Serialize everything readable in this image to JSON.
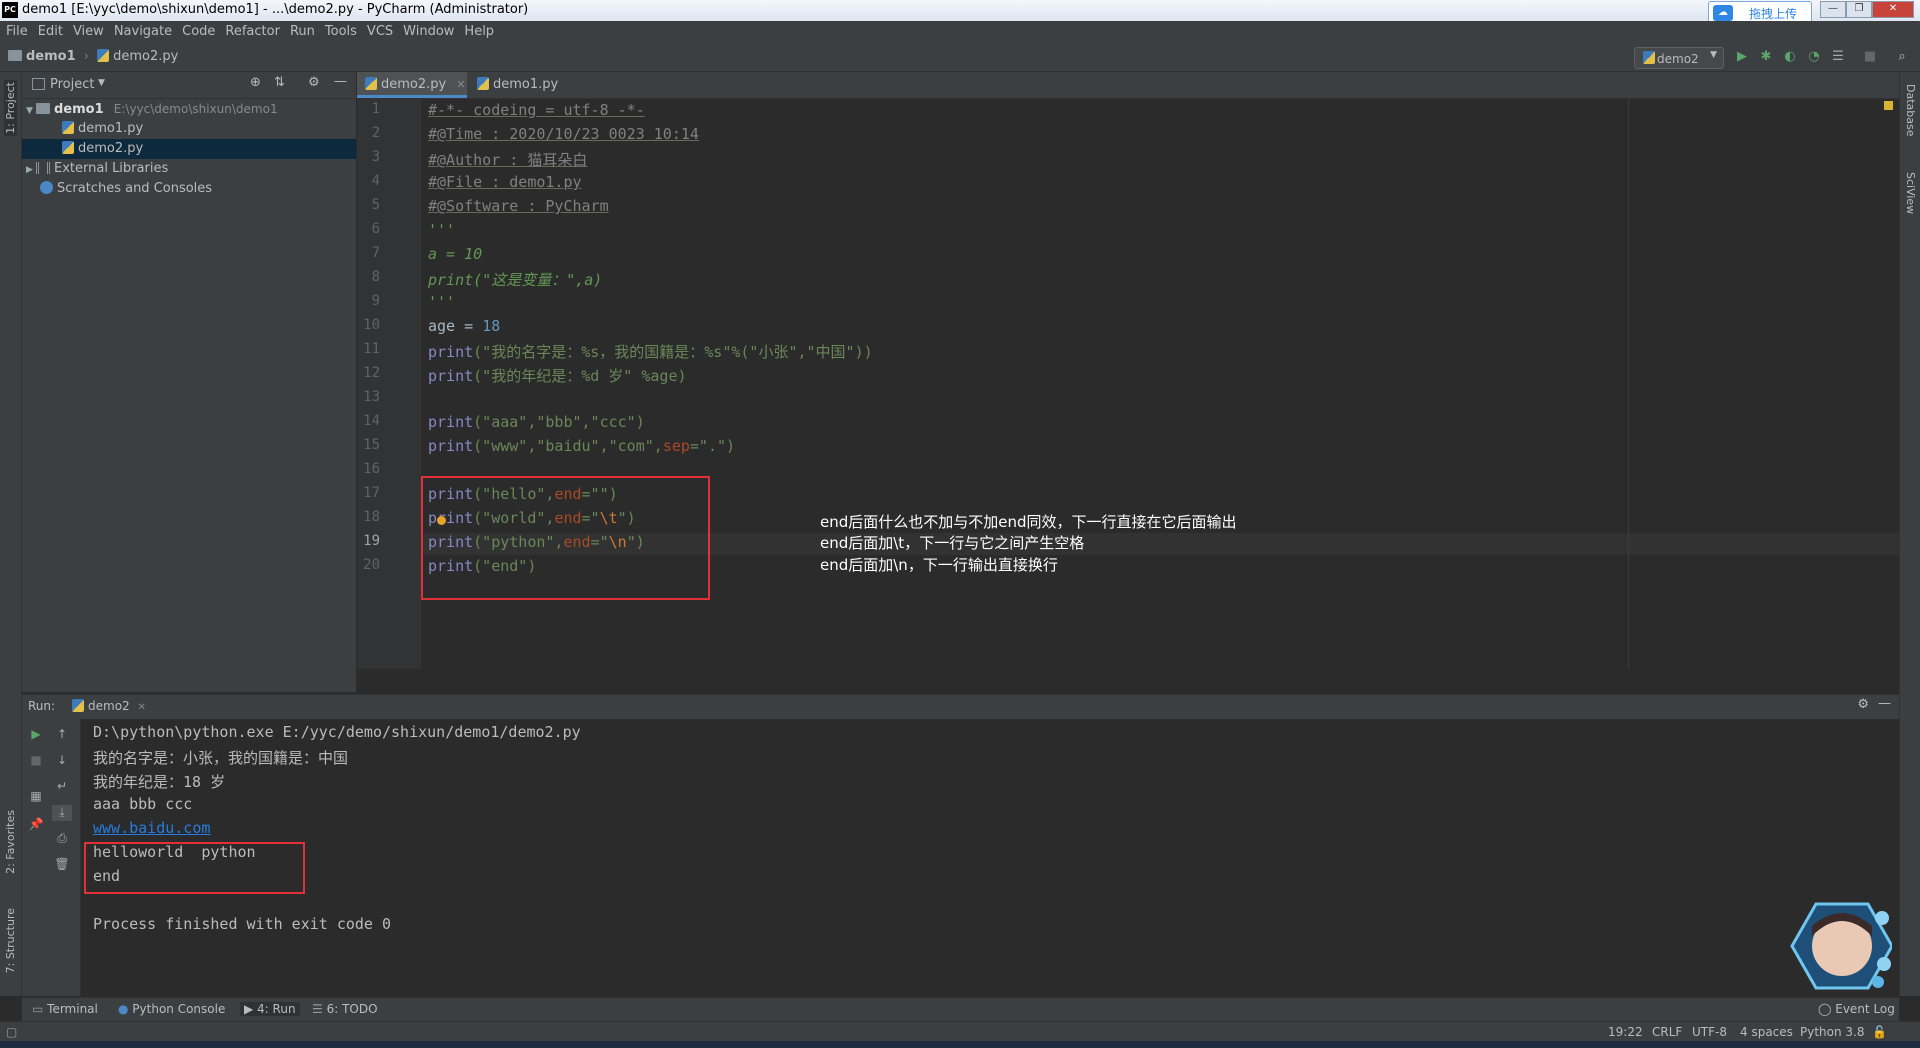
{
  "window": {
    "title": "demo1 [E:\\yyc\\demo\\shixun\\demo1] - ...\\demo2.py - PyCharm (Administrator)",
    "upload_label": "拖拽上传"
  },
  "menu": [
    "File",
    "Edit",
    "View",
    "Navigate",
    "Code",
    "Refactor",
    "Run",
    "Tools",
    "VCS",
    "Window",
    "Help"
  ],
  "breadcrumb": {
    "project": "demo1",
    "file": "demo2.py"
  },
  "run_config": "demo2",
  "left_strip": {
    "project_tab": "1: Project",
    "favorites_tab": "2: Favorites",
    "structure_tab": "7: Structure"
  },
  "right_strip": {
    "database_tab": "Database",
    "sciview_tab": "SciView"
  },
  "project_panel": {
    "title": "Project",
    "root": {
      "name": "demo1",
      "path": "E:\\yyc\\demo\\shixun\\demo1"
    },
    "files": [
      "demo1.py",
      "demo2.py"
    ],
    "selected": "demo2.py",
    "external": "External Libraries",
    "scratches": "Scratches and Consoles"
  },
  "tabs": [
    {
      "label": "demo2.py",
      "active": true
    },
    {
      "label": "demo1.py",
      "active": false
    }
  ],
  "line_numbers": [
    "1",
    "2",
    "3",
    "4",
    "5",
    "6",
    "7",
    "8",
    "9",
    "10",
    "11",
    "12",
    "13",
    "14",
    "15",
    "16",
    "17",
    "18",
    "19",
    "20"
  ],
  "code": {
    "l1": "#-*- codeing = utf-8 -*-",
    "l2": "#@Time : 2020/10/23 0023 10:14",
    "l3": "#@Author : 猫耳朵白",
    "l4": "#@File : demo1.py",
    "l5": "#@Software : PyCharm",
    "l6": "'''",
    "l7": "a = 10",
    "l8": "print(\"这是变量：\",a)",
    "l9": "'''",
    "l10": {
      "a": "age = ",
      "b": "18"
    },
    "l11": {
      "f": "print",
      "s": "(\"我的名字是：%s，我的国籍是：%s\"%(\"小张\",\"中国\"))"
    },
    "l12": {
      "f": "print",
      "s": "(\"我的年纪是：%d 岁\" %age)"
    },
    "l14": {
      "f": "print",
      "s": "(\"aaa\",\"bbb\",\"ccc\")"
    },
    "l15": {
      "f": "print",
      "p1": "(\"www\",\"baidu\",\"com\",",
      "k": "sep",
      "p2": "=\".\")"
    },
    "l17": {
      "f": "print",
      "p1": "(\"hello\",",
      "k": "end",
      "p2": "=\"\")"
    },
    "l18": {
      "f": "print",
      "p1": "(\"world\",",
      "k": "end",
      "p2a": "=\"",
      "e": "\\t",
      "p2b": "\")"
    },
    "l19": {
      "f": "print",
      "p1": "(\"python\",",
      "k": "end",
      "p2a": "=\"",
      "e": "\\n",
      "p2b": "\")"
    },
    "l20": {
      "f": "print",
      "s": "(\"end\")"
    }
  },
  "notes": [
    "end后面什么也不加与不加end同效，下一行直接在它后面输出",
    "end后面加\\t，下一行与它之间产生空格",
    "end后面加\\n，下一行输出直接换行"
  ],
  "run_panel": {
    "label": "Run:",
    "tab": "demo2",
    "output": [
      "D:\\python\\python.exe E:/yyc/demo/shixun/demo1/demo2.py",
      "我的名字是：小张，我的国籍是：中国",
      "我的年纪是：18 岁",
      "aaa bbb ccc",
      "www.baidu.com",
      "helloworld  python",
      "end",
      "",
      "Process finished with exit code 0"
    ]
  },
  "bottom_tabs": [
    "Terminal",
    "Python Console",
    "4: Run",
    "6: TODO"
  ],
  "event_log": "Event Log",
  "status": {
    "position": "19:22",
    "line_sep": "CRLF",
    "encoding": "UTF-8",
    "indent": "4 spaces",
    "interpreter": "Python 3.8"
  }
}
